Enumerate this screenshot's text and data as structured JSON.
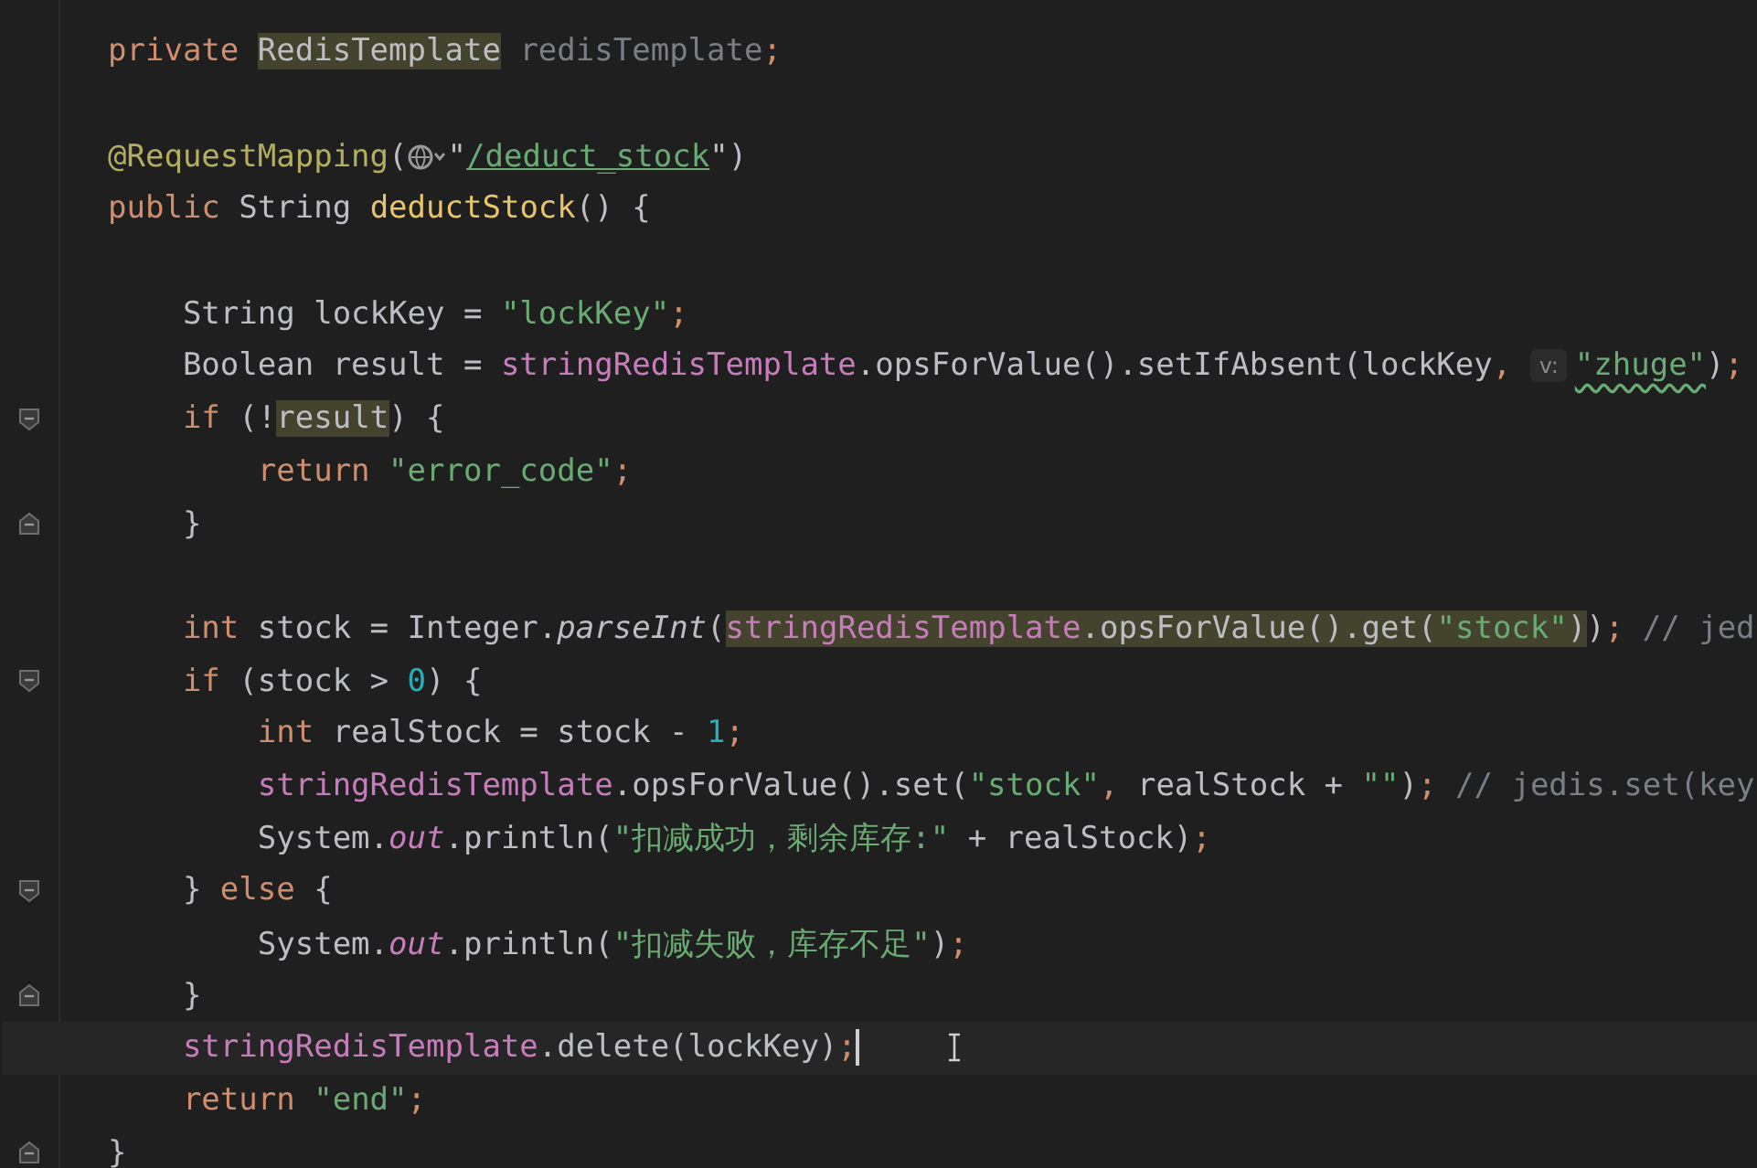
{
  "editor": {
    "lines": [
      {
        "kind": "code",
        "current": false,
        "tokens": [
          {
            "kind": "kw",
            "t": "private "
          },
          {
            "kind": "highlight",
            "parts": [
              {
                "kind": "plain",
                "t": "RedisTemplate"
              }
            ]
          },
          {
            "kind": "unused",
            "t": " redisTemplate"
          },
          {
            "kind": "kw",
            "t": ";"
          }
        ]
      },
      {
        "kind": "code",
        "current": false
      },
      {
        "kind": "code",
        "current": false,
        "tokens": [
          {
            "kind": "ann",
            "t": "@RequestMapping"
          },
          {
            "kind": "plain",
            "t": "("
          },
          {
            "kind": "globe"
          },
          {
            "kind": "plain",
            "t": "\""
          },
          {
            "kind": "url",
            "t": "/deduct_stock"
          },
          {
            "kind": "plain",
            "t": "\")"
          }
        ]
      },
      {
        "kind": "code",
        "current": false,
        "tokens": [
          {
            "kind": "kw",
            "t": "public "
          },
          {
            "kind": "plain",
            "t": "String "
          },
          {
            "kind": "fn",
            "t": "deductStock"
          },
          {
            "kind": "plain",
            "t": "() {"
          }
        ]
      },
      {
        "kind": "code",
        "current": false
      },
      {
        "kind": "code",
        "current": false,
        "tokens": [
          {
            "kind": "plain",
            "t": "    String lockKey = "
          },
          {
            "kind": "str",
            "t": "\"lockKey\""
          },
          {
            "kind": "kw",
            "t": ";"
          }
        ]
      },
      {
        "kind": "code",
        "current": false,
        "tokens": [
          {
            "kind": "plain",
            "t": "    Boolean result = "
          },
          {
            "kind": "field",
            "t": "stringRedisTemplate"
          },
          {
            "kind": "plain",
            "t": ".opsForValue().setIfAbsent(lockKey"
          },
          {
            "kind": "kw",
            "t": ", "
          },
          {
            "kind": "hint",
            "t": "v:"
          },
          {
            "kind": "str-warn",
            "t": "\"zhuge\""
          },
          {
            "kind": "plain",
            "t": ")"
          },
          {
            "kind": "kw",
            "t": ";"
          }
        ]
      },
      {
        "kind": "fold-open",
        "current": false,
        "tokens": [
          {
            "kind": "kw",
            "t": "    if "
          },
          {
            "kind": "plain",
            "t": "(!"
          },
          {
            "kind": "highlight",
            "parts": [
              {
                "kind": "plain",
                "t": "result"
              }
            ]
          },
          {
            "kind": "plain",
            "t": ") {"
          }
        ]
      },
      {
        "kind": "code",
        "current": false,
        "tokens": [
          {
            "kind": "kw",
            "t": "        return "
          },
          {
            "kind": "str",
            "t": "\"error_code\""
          },
          {
            "kind": "kw",
            "t": ";"
          }
        ]
      },
      {
        "kind": "fold-close",
        "current": false,
        "tokens": [
          {
            "kind": "plain",
            "t": "    }"
          }
        ]
      },
      {
        "kind": "code",
        "current": false
      },
      {
        "kind": "code",
        "current": false,
        "tokens": [
          {
            "kind": "kw",
            "t": "    int "
          },
          {
            "kind": "plain",
            "t": "stock = Integer."
          },
          {
            "kind": "italic",
            "t": "parseInt"
          },
          {
            "kind": "plain",
            "t": "("
          },
          {
            "kind": "highlight",
            "parts": [
              {
                "kind": "field",
                "t": "stringRedisTemplate"
              },
              {
                "kind": "plain",
                "t": ".opsForValue().get("
              },
              {
                "kind": "str",
                "t": "\"stock\""
              },
              {
                "kind": "plain",
                "t": ")"
              }
            ]
          },
          {
            "kind": "plain",
            "t": ")"
          },
          {
            "kind": "kw",
            "t": "; "
          },
          {
            "kind": "comment",
            "t": "// jed"
          }
        ]
      },
      {
        "kind": "fold-open",
        "current": false,
        "tokens": [
          {
            "kind": "kw",
            "t": "    if "
          },
          {
            "kind": "plain",
            "t": "(stock > "
          },
          {
            "kind": "num",
            "t": "0"
          },
          {
            "kind": "plain",
            "t": ") {"
          }
        ]
      },
      {
        "kind": "code",
        "current": false,
        "tokens": [
          {
            "kind": "kw",
            "t": "        int "
          },
          {
            "kind": "plain",
            "t": "realStock = stock - "
          },
          {
            "kind": "num",
            "t": "1"
          },
          {
            "kind": "kw",
            "t": ";"
          }
        ]
      },
      {
        "kind": "code",
        "current": false,
        "tokens": [
          {
            "kind": "field",
            "t": "        stringRedisTemplate"
          },
          {
            "kind": "plain",
            "t": ".opsForValue().set("
          },
          {
            "kind": "str",
            "t": "\"stock\""
          },
          {
            "kind": "kw",
            "t": ", "
          },
          {
            "kind": "plain",
            "t": "realStock + "
          },
          {
            "kind": "str",
            "t": "\"\""
          },
          {
            "kind": "plain",
            "t": ")"
          },
          {
            "kind": "kw",
            "t": "; "
          },
          {
            "kind": "comment",
            "t": "// jedis.set(key"
          }
        ]
      },
      {
        "kind": "code",
        "current": false,
        "tokens": [
          {
            "kind": "plain",
            "t": "        System."
          },
          {
            "kind": "field-italic",
            "t": "out"
          },
          {
            "kind": "plain",
            "t": ".println("
          },
          {
            "kind": "str",
            "t": "\"扣减成功，剩余库存:\""
          },
          {
            "kind": "plain",
            "t": " + realStock)"
          },
          {
            "kind": "kw",
            "t": ";"
          }
        ]
      },
      {
        "kind": "fold-open",
        "current": false,
        "tokens": [
          {
            "kind": "plain",
            "t": "    } "
          },
          {
            "kind": "kw",
            "t": "else "
          },
          {
            "kind": "plain",
            "t": "{"
          }
        ]
      },
      {
        "kind": "code",
        "current": false,
        "tokens": [
          {
            "kind": "plain",
            "t": "        System."
          },
          {
            "kind": "field-italic",
            "t": "out"
          },
          {
            "kind": "plain",
            "t": ".println("
          },
          {
            "kind": "str",
            "t": "\"扣减失败，库存不足\""
          },
          {
            "kind": "plain",
            "t": ")"
          },
          {
            "kind": "kw",
            "t": ";"
          }
        ]
      },
      {
        "kind": "fold-close",
        "current": false,
        "tokens": [
          {
            "kind": "plain",
            "t": "    }"
          }
        ]
      },
      {
        "kind": "code",
        "current": true,
        "tokens": [
          {
            "kind": "field",
            "t": "    stringRedisTemplate"
          },
          {
            "kind": "plain",
            "t": ".delete(lockKey)"
          },
          {
            "kind": "kw",
            "t": ";"
          }
        ]
      },
      {
        "kind": "code",
        "current": false,
        "tokens": [
          {
            "kind": "kw",
            "t": "    return "
          },
          {
            "kind": "str",
            "t": "\"end\""
          },
          {
            "kind": "kw",
            "t": ";"
          }
        ]
      },
      {
        "kind": "fold-close",
        "current": false,
        "tokens": [
          {
            "kind": "plain",
            "t": "}"
          }
        ]
      }
    ]
  }
}
